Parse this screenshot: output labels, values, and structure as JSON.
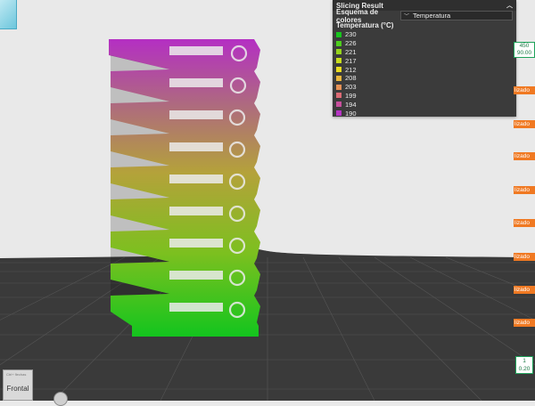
{
  "panel": {
    "title": "Slicing Result",
    "scheme_label": "Esquema de colores",
    "scheme_value": "Temperatura",
    "legend_title": "Temperatura (°C)",
    "legend": [
      {
        "value": "230",
        "color": "#17c51d"
      },
      {
        "value": "226",
        "color": "#4dcd1c"
      },
      {
        "value": "221",
        "color": "#95d41b"
      },
      {
        "value": "217",
        "color": "#c7dc1d"
      },
      {
        "value": "212",
        "color": "#e9dc1f"
      },
      {
        "value": "208",
        "color": "#e9b53b"
      },
      {
        "value": "203",
        "color": "#e79156"
      },
      {
        "value": "199",
        "color": "#dc6a74"
      },
      {
        "value": "194",
        "color": "#c74f9c"
      },
      {
        "value": "190",
        "color": "#b634c4"
      }
    ]
  },
  "right_tags": [
    "lizado",
    "lizado",
    "lizado",
    "lizado",
    "lizado",
    "lizado",
    "lizado",
    "lizado"
  ],
  "layer_top": {
    "layer": "450",
    "height": "90.00"
  },
  "layer_bottom": {
    "layer": "1",
    "height": "0.20"
  },
  "view_button": {
    "small": "Ctrl+ flechas",
    "label": "Frontal"
  },
  "icons": {
    "view_cube": "view-cube-icon",
    "collapse": "chevron-up-icon",
    "camera": "camera-icon"
  }
}
